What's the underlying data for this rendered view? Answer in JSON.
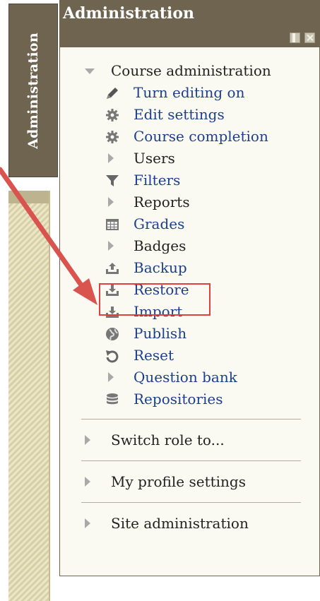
{
  "dock": {
    "tab_label": "Administration"
  },
  "block": {
    "title": "Administration",
    "course_admin": {
      "label": "Course administration",
      "items": [
        {
          "label": "Turn editing on",
          "icon": "pencil-icon",
          "link": true
        },
        {
          "label": "Edit settings",
          "icon": "gear-icon",
          "link": true
        },
        {
          "label": "Course completion",
          "icon": "gear-icon",
          "link": true
        },
        {
          "label": "Users",
          "icon": "expand-triangle",
          "link": false
        },
        {
          "label": "Filters",
          "icon": "filter-icon",
          "link": true
        },
        {
          "label": "Reports",
          "icon": "expand-triangle",
          "link": false
        },
        {
          "label": "Grades",
          "icon": "grades-icon",
          "link": true
        },
        {
          "label": "Badges",
          "icon": "expand-triangle",
          "link": false
        },
        {
          "label": "Backup",
          "icon": "backup-icon",
          "link": true
        },
        {
          "label": "Restore",
          "icon": "restore-icon",
          "link": true
        },
        {
          "label": "Import",
          "icon": "import-icon",
          "link": true
        },
        {
          "label": "Publish",
          "icon": "globe-icon",
          "link": true
        },
        {
          "label": "Reset",
          "icon": "reset-icon",
          "link": true
        },
        {
          "label": "Question bank",
          "icon": "expand-triangle",
          "link": true
        },
        {
          "label": "Repositories",
          "icon": "database-icon",
          "link": true
        }
      ]
    },
    "sections": [
      {
        "label": "Switch role to..."
      },
      {
        "label": "My profile settings"
      },
      {
        "label": "Site administration"
      }
    ]
  },
  "annotation": {
    "highlight_color": "#e04040",
    "arrow_color": "#d9534f"
  }
}
